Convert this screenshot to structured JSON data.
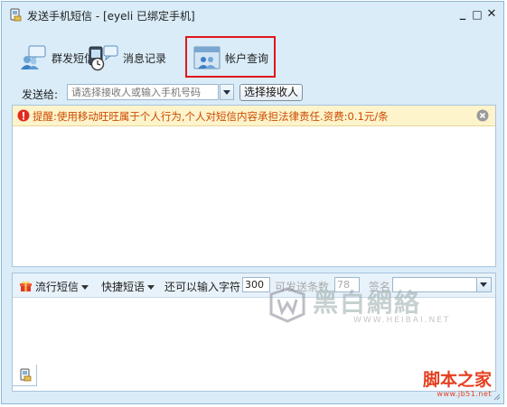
{
  "window": {
    "title": "发送手机短信 - [eyeli 已绑定手机]",
    "minimize": "_",
    "maximize": "□",
    "close": "✕"
  },
  "toolbar": {
    "items": [
      {
        "label": "群发短信",
        "icon": "group-sms-icon"
      },
      {
        "label": "消息记录",
        "icon": "message-history-icon"
      },
      {
        "label": "帐户查询",
        "icon": "account-query-icon"
      }
    ],
    "highlight_color": "#e0161b"
  },
  "send": {
    "label": "发送给:",
    "placeholder": "请选择接收人或输入手机号码",
    "pick_button": "选择接收人"
  },
  "warning": {
    "text": "提醒:使用移动旺旺属于个人行为,个人对短信内容承担法律责任.资费:0.1元/条",
    "color": "#cc4a00"
  },
  "compose": {
    "popular": "流行短信",
    "quick": "快捷短语",
    "remaining_label": "还可以输入字符",
    "remaining_value": "300",
    "send_count_label": "可发送条数",
    "send_count_value": "78",
    "signature_label": "签名"
  },
  "watermark": {
    "text": "黑白網絡",
    "url": "WWW.HEIBAI.NET"
  },
  "brand": {
    "name": "脚本之家",
    "url": "www.jb51.net"
  }
}
